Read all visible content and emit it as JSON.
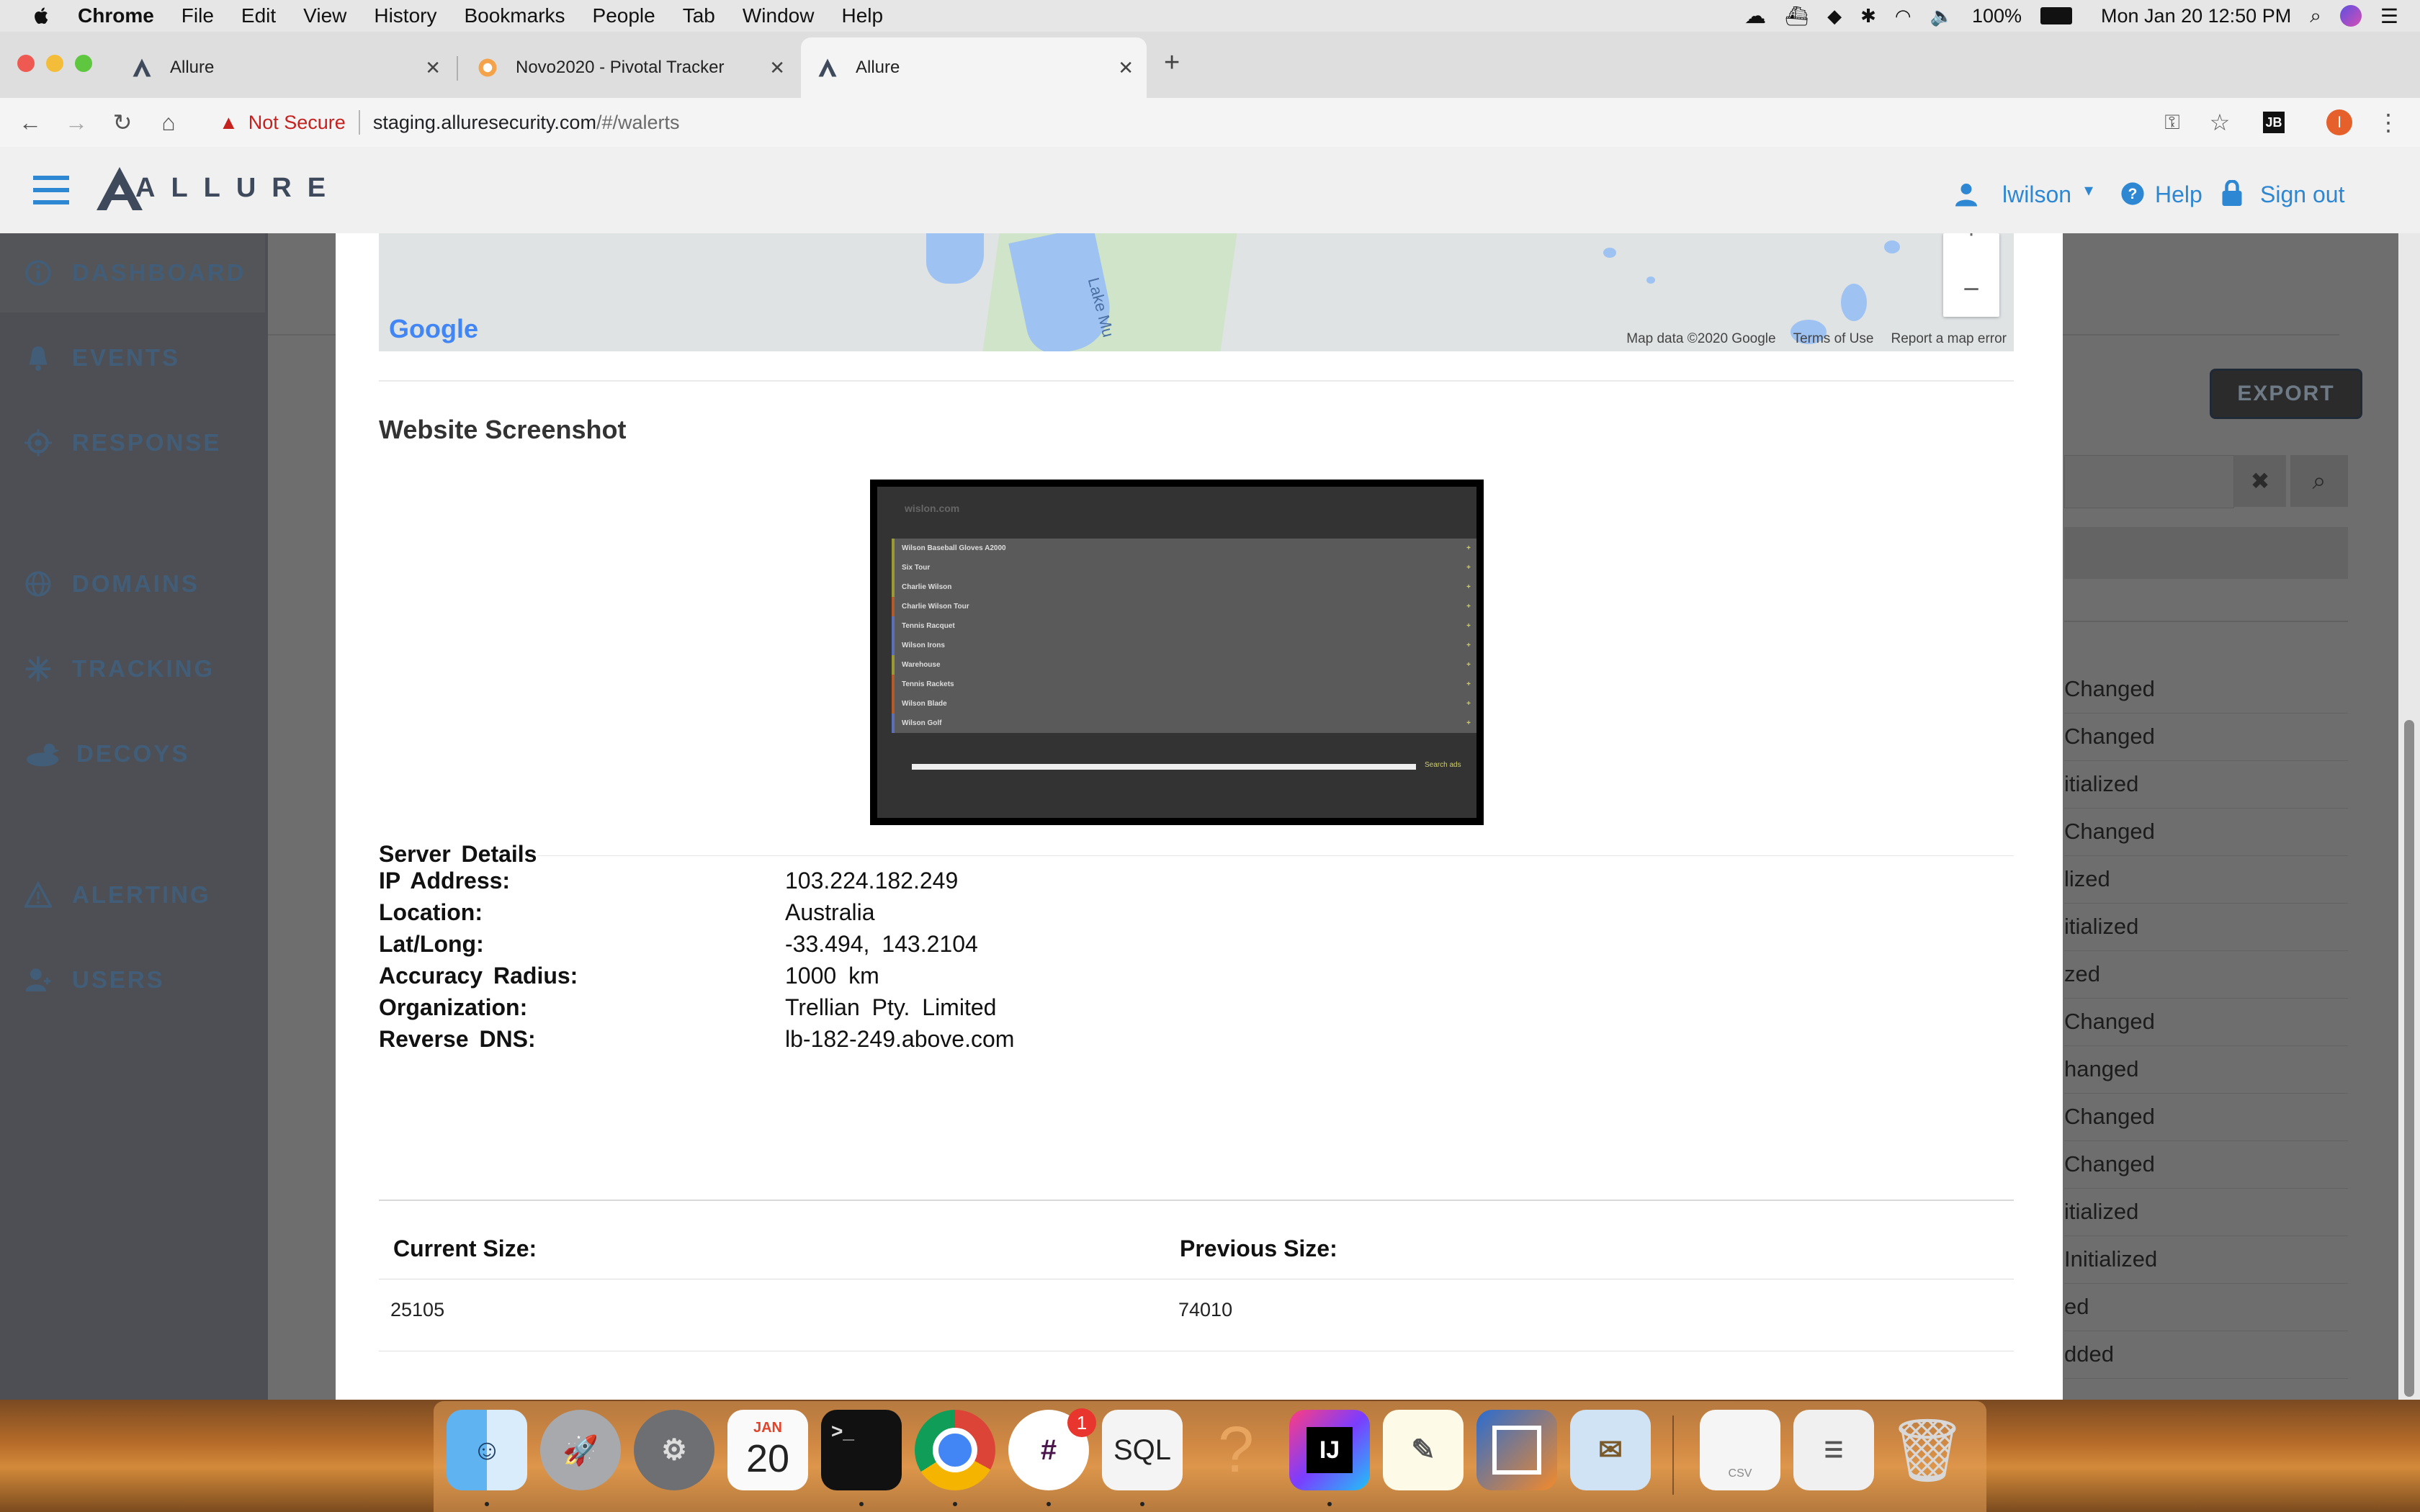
{
  "menubar": {
    "app": "Chrome",
    "items": [
      "File",
      "Edit",
      "View",
      "History",
      "Bookmarks",
      "People",
      "Tab",
      "Window",
      "Help"
    ],
    "battery": "100%",
    "datetime": "Mon Jan 20  12:50 PM"
  },
  "browser": {
    "tabs": [
      {
        "title": "Allure",
        "icon": "allure-logo-icon"
      },
      {
        "title": "Novo2020 - Pivotal Tracker",
        "icon": "pivotal-tracker-icon"
      },
      {
        "title": "Allure",
        "icon": "allure-logo-icon"
      }
    ],
    "address": {
      "security_label": "Not Secure",
      "host": "staging.alluresecurity.com",
      "path": "/#/walerts"
    },
    "profile_initial": "I"
  },
  "app_header": {
    "logo": "ALLURE",
    "user": "lwilson",
    "help": "Help",
    "signout": "Sign out"
  },
  "sidebar": {
    "items": [
      {
        "label": "DASHBOARD",
        "icon": "info-circle-icon"
      },
      {
        "label": "EVENTS",
        "icon": "bell-icon"
      },
      {
        "label": "RESPONSE",
        "icon": "crosshair-icon"
      },
      {
        "label": "DOMAINS",
        "icon": "globe-icon"
      },
      {
        "label": "TRACKING",
        "icon": "asterisk-icon"
      },
      {
        "label": "DECOYS",
        "icon": "duck-icon"
      },
      {
        "label": "ALERTING",
        "icon": "warning-triangle-icon"
      },
      {
        "label": "USERS",
        "icon": "users-icon"
      }
    ]
  },
  "background": {
    "export_label": "EXPORT",
    "rows": [
      "Changed",
      "Changed",
      "itialized",
      "Changed",
      "lized",
      "itialized",
      "zed",
      "Changed",
      "hanged",
      "Changed",
      "Changed",
      "itialized",
      "Initialized",
      "ed",
      "dded"
    ]
  },
  "map": {
    "label": "Lake Mu",
    "google": "Google",
    "credits": [
      "Map data ©2020 Google",
      "Terms of Use",
      "Report a map error"
    ],
    "zoom_in": "+",
    "zoom_out": "−"
  },
  "screenshot_section": {
    "title": "Website Screenshot",
    "site_header": "wislon.com",
    "items": [
      "Wilson Baseball Gloves A2000",
      "Six Tour",
      "Charlie Wilson",
      "Charlie Wilson Tour",
      "Tennis Racquet",
      "Wilson Irons",
      "Warehouse",
      "Tennis Rackets",
      "Wilson Blade",
      "Wilson Golf"
    ],
    "search_label": "Search ads"
  },
  "server_details": {
    "title": "Server Details",
    "rows": [
      {
        "key": "IP Address:",
        "value": "103.224.182.249"
      },
      {
        "key": "Location:",
        "value": "Australia"
      },
      {
        "key": "Lat/Long:",
        "value": "-33.494, 143.2104"
      },
      {
        "key": "Accuracy Radius:",
        "value": "1000 km"
      },
      {
        "key": "Organization:",
        "value": "Trellian Pty. Limited"
      },
      {
        "key": "Reverse DNS:",
        "value": "lb-182-249.above.com"
      }
    ]
  },
  "sizes": {
    "current_label": "Current Size:",
    "previous_label": "Previous Size:",
    "current_value": "25105",
    "previous_value": "74010"
  },
  "dock": {
    "calendar_month": "JAN",
    "calendar_day": "20",
    "slack_badge": "1",
    "sql_label": "SQL",
    "ij_label": "IJ",
    "csv_label": "CSV"
  },
  "colors": {
    "accent_blue": "#2e87d3",
    "not_secure_red": "#c5221f",
    "logo_navy": "#3e4a5c"
  }
}
